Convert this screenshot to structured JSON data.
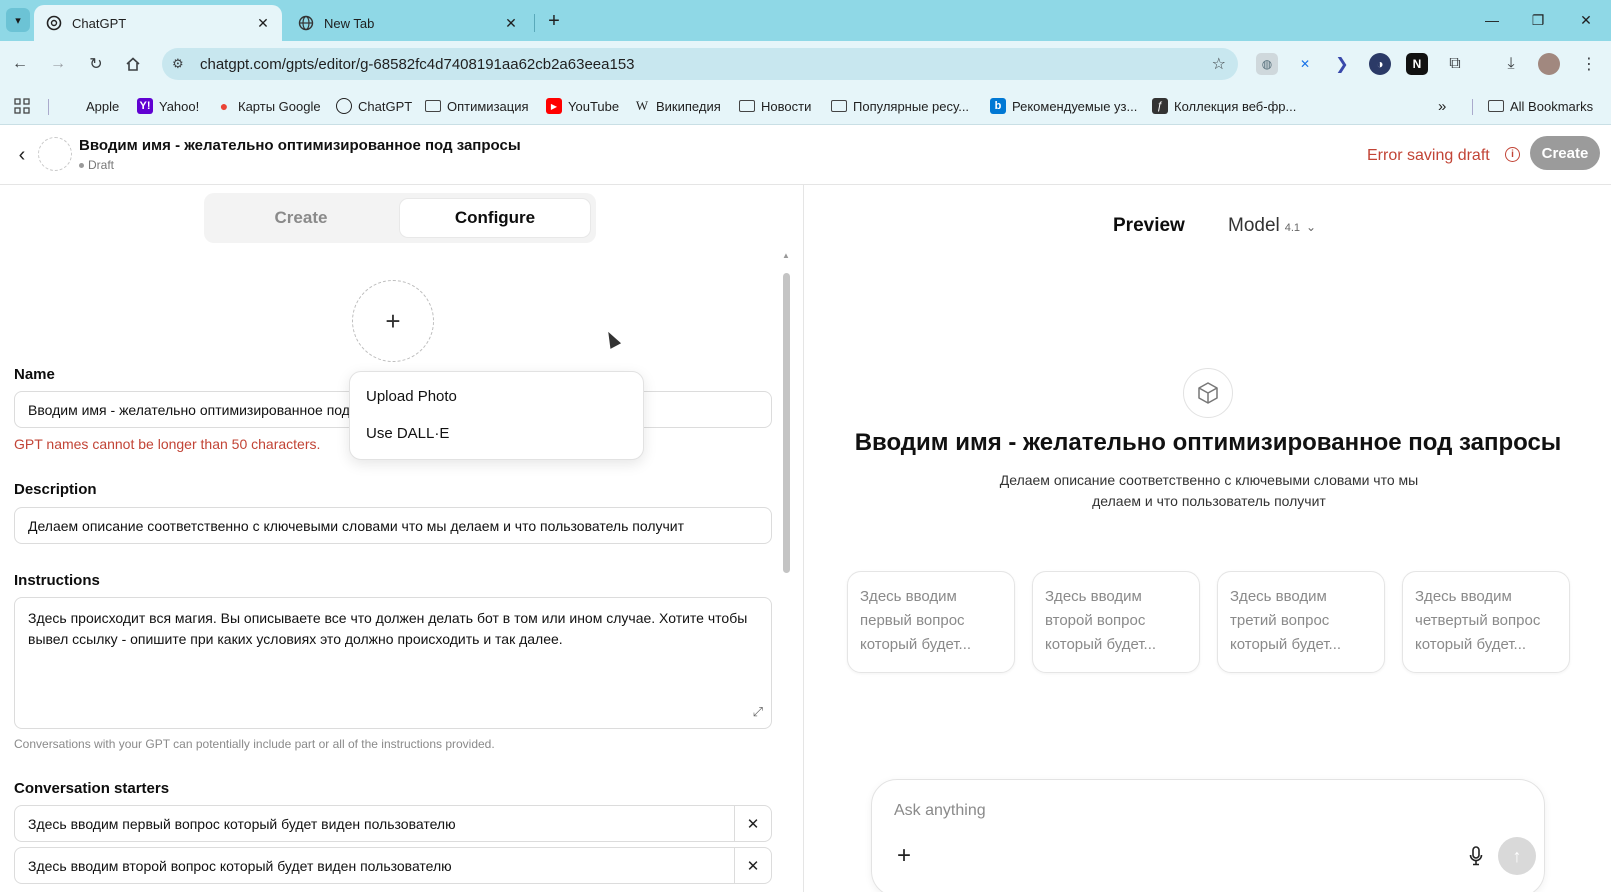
{
  "browser": {
    "tabs": [
      {
        "label": "ChatGPT",
        "active": true
      },
      {
        "label": "New Tab",
        "active": false
      }
    ],
    "url": "chatgpt.com/gpts/editor/g-68582fc4d7408191aa62cb2a63eea153",
    "bookmarks": [
      {
        "label": "Apple",
        "icon": "apple-icon"
      },
      {
        "label": "Yahoo!",
        "icon": "yahoo-icon"
      },
      {
        "label": "Карты Google",
        "icon": "maps-pin-icon"
      },
      {
        "label": "ChatGPT",
        "icon": "chatgpt-icon"
      },
      {
        "label": "Оптимизация",
        "icon": "folder-icon"
      },
      {
        "label": "YouTube",
        "icon": "youtube-icon"
      },
      {
        "label": "Википедия",
        "icon": "wikipedia-icon"
      },
      {
        "label": "Новости",
        "icon": "folder-icon"
      },
      {
        "label": "Популярные ресу...",
        "icon": "folder-icon"
      },
      {
        "label": "Рекомендуемые уз...",
        "icon": "bing-icon"
      },
      {
        "label": "Коллекция веб-фр...",
        "icon": "webslice-icon"
      }
    ],
    "all_bookmarks": "All Bookmarks"
  },
  "header": {
    "title": "Вводим имя - желательно оптимизированное под запросы",
    "status": "Draft",
    "error": "Error saving draft",
    "create_label": "Create"
  },
  "editor": {
    "tabs": {
      "create": "Create",
      "configure": "Configure",
      "selected": "Configure"
    },
    "name": {
      "label": "Name",
      "value": "Вводим имя - желательно оптимизированное под запросы",
      "error": "GPT names cannot be longer than 50 characters."
    },
    "description": {
      "label": "Description",
      "value": "Делаем описание соответственно с ключевыми словами что мы делаем и что пользователь получит"
    },
    "instructions": {
      "label": "Instructions",
      "value": "Здесь происходит вся магия. Вы описываете все что должен делать бот в том или ином случае. Хотите чтобы вывел ссылку - опишите при каких условиях это должно происходить и так далее.",
      "hint": "Conversations with your GPT can potentially include part or all of the instructions provided."
    },
    "starters": {
      "label": "Conversation starters",
      "items": [
        "Здесь вводим первый вопрос который будет виден пользователю",
        "Здесь вводим второй вопрос который будет виден пользователю"
      ]
    },
    "upload_menu": [
      "Upload Photo",
      "Use DALL·E"
    ]
  },
  "preview": {
    "label": "Preview",
    "model_label": "Model",
    "model_version": "4.1",
    "title": "Вводим имя - желательно оптимизированное под запросы",
    "description": "Делаем описание соответственно с ключевыми словами что мы делаем и что пользователь получит",
    "cards": [
      "Здесь вводим первый вопрос который будет...",
      "Здесь вводим второй вопрос который будет...",
      "Здесь вводим третий вопрос который будет...",
      "Здесь вводим четвертый вопрос который будет..."
    ],
    "composer_placeholder": "Ask anything"
  },
  "colors": {
    "tabbar": "#8fd8e6",
    "toolbar": "#e6f5f9",
    "error": "#c24436",
    "create_button": "#9b9b9b"
  }
}
